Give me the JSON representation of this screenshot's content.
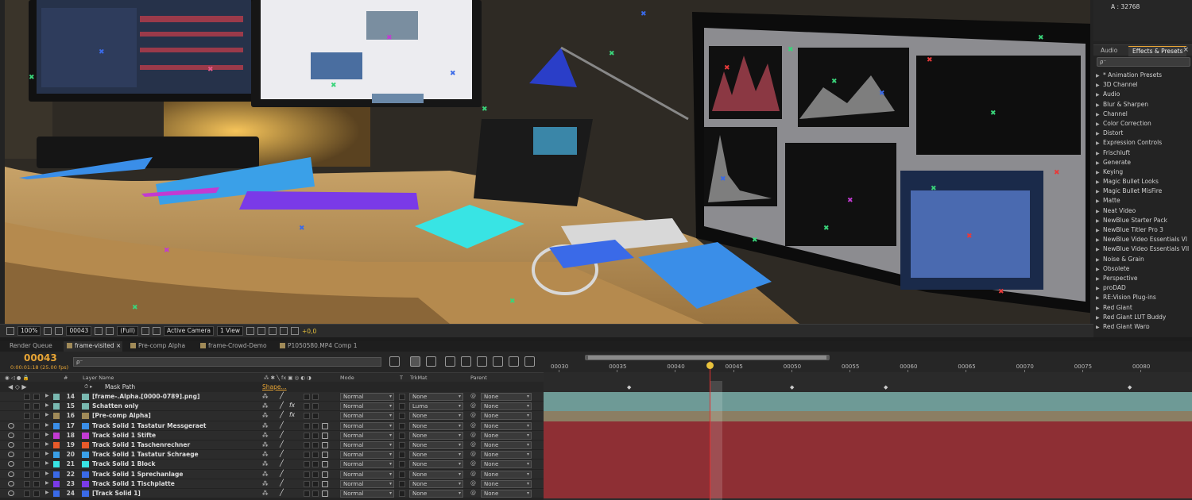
{
  "side_panel": {
    "top_readout": "A :  32768",
    "tabs": [
      "Audio",
      "Effects & Presets"
    ],
    "search_placeholder": "ρ⁻",
    "effects": [
      "* Animation Presets",
      "3D Channel",
      "Audio",
      "Blur & Sharpen",
      "Channel",
      "Color Correction",
      "Distort",
      "Expression Controls",
      "Frischluft",
      "Generate",
      "Keying",
      "Magic Bullet Looks",
      "Magic Bullet MisFire",
      "Matte",
      "Neat Video",
      "NewBlue Starter Pack",
      "NewBlue Titler Pro 3",
      "NewBlue Video Essentials VI",
      "NewBlue Video Essentials VII",
      "Noise & Grain",
      "Obsolete",
      "Perspective",
      "proDAD",
      "RE:Vision Plug-ins",
      "Red Giant",
      "Red Giant LUT Buddy",
      "Red Giant Warp"
    ]
  },
  "viewer_bar": {
    "zoom": "100%",
    "frame": "00043",
    "resolution": "(Full)",
    "camera": "Active Camera",
    "views": "1 View",
    "exposure": "+0,0"
  },
  "timeline_tabs": [
    "Render Queue",
    "frame-visited",
    "Pre-comp Alpha",
    "frame-Crowd-Demo",
    "P1050580.MP4 Comp 1"
  ],
  "timeline": {
    "timecode": "00043",
    "timecode_sub": "0:00:01:18 (25.00 fps)",
    "search_placeholder": "ρ⁻",
    "ruler": [
      "00030",
      "00035",
      "00040",
      "00045",
      "00050",
      "00055",
      "00060",
      "00065",
      "00070",
      "00075",
      "00080"
    ],
    "headers": {
      "layer_name": "Layer Name",
      "mode": "Mode",
      "t": "T",
      "trkmat": "TrkMat",
      "parent": "Parent",
      "shape": "Shape..."
    },
    "mask_path": "Mask Path",
    "layers": [
      {
        "num": "14",
        "name": "[frame-.Alpha.[0000-0789].png]",
        "color": "#79b8b0",
        "mode": "Normal",
        "trkmat": "None",
        "parent": "None",
        "bar": "#6e9a96",
        "fx": "",
        "eye": false
      },
      {
        "num": "15",
        "name": "Schatten only",
        "color": "#79b8b0",
        "mode": "Normal",
        "trkmat": "Luma",
        "parent": "None",
        "bar": "#6e9a96",
        "fx": "fx",
        "eye": false
      },
      {
        "num": "16",
        "name": "[Pre-comp Alpha]",
        "color": "#a08a58",
        "mode": "Normal",
        "trkmat": "None",
        "parent": "None",
        "bar": "#8b7e63",
        "fx": "fx",
        "eye": false
      },
      {
        "num": "17",
        "name": "Track Solid 1 Tastatur Messgeraet",
        "color": "#3a8ee8",
        "mode": "Normal",
        "trkmat": "None",
        "parent": "None",
        "bar": "#8e2f34",
        "fx": "",
        "eye": true
      },
      {
        "num": "18",
        "name": "Track Solid 1 Stifte",
        "color": "#c23ad2",
        "mode": "Normal",
        "trkmat": "None",
        "parent": "None",
        "bar": "#8e2f34",
        "fx": "",
        "eye": true
      },
      {
        "num": "19",
        "name": "Track Solid 1 Taschenrechner",
        "color": "#e85a2a",
        "mode": "Normal",
        "trkmat": "None",
        "parent": "None",
        "bar": "#8e2f34",
        "fx": "",
        "eye": true
      },
      {
        "num": "20",
        "name": "Track Solid 1 Tastatur Schraege",
        "color": "#3aa0e8",
        "mode": "Normal",
        "trkmat": "None",
        "parent": "None",
        "bar": "#8e2f34",
        "fx": "",
        "eye": true
      },
      {
        "num": "21",
        "name": "Track Solid 1 Block",
        "color": "#38e4e4",
        "mode": "Normal",
        "trkmat": "None",
        "parent": "None",
        "bar": "#8e2f34",
        "fx": "",
        "eye": true
      },
      {
        "num": "22",
        "name": "Track Solid 1 Sprechanlage",
        "color": "#3a6ae8",
        "mode": "Normal",
        "trkmat": "None",
        "parent": "None",
        "bar": "#8e2f34",
        "fx": "",
        "eye": true
      },
      {
        "num": "23",
        "name": "Track Solid 1 Tischplatte",
        "color": "#7a3ae8",
        "mode": "Normal",
        "trkmat": "None",
        "parent": "None",
        "bar": "#8e2f34",
        "fx": "",
        "eye": true
      },
      {
        "num": "24",
        "name": "[Track Solid 1]",
        "color": "#3a6ae8",
        "mode": "Normal",
        "trkmat": "None",
        "parent": "None",
        "bar": "#8e2f34",
        "fx": "",
        "eye": true
      }
    ]
  }
}
